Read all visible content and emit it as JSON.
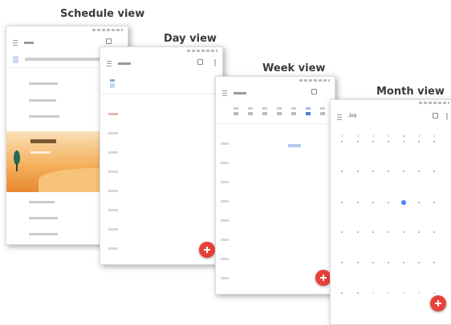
{
  "labels": {
    "schedule": "Schedule view",
    "day": "Day view",
    "week": "Week view",
    "month": "Month view"
  },
  "month_view": {
    "app_title": "July"
  },
  "colors": {
    "fab": "#e8403a",
    "accent": "#4285f4",
    "banner": "#f0a844"
  },
  "icons": [
    "menu-icon",
    "calendar-icon",
    "more-vert-icon",
    "add-icon",
    "tree-icon"
  ]
}
